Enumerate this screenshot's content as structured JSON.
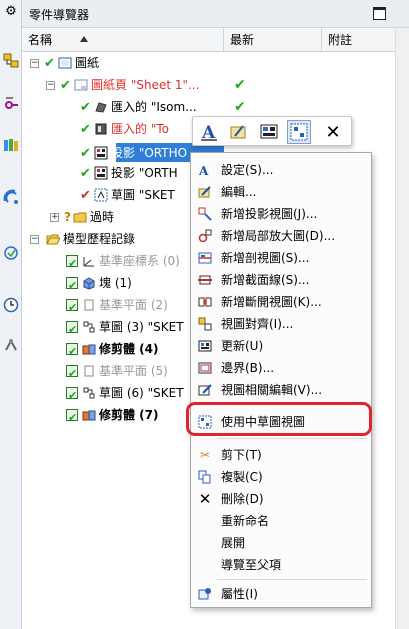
{
  "panel": {
    "title": "零件導覽器",
    "columns": {
      "name": "名稱",
      "latest": "最新",
      "note": "附註"
    }
  },
  "tree": {
    "drawing": "圖紙",
    "sheet": "圖紙頁 \"Sheet 1\"...",
    "import1": "匯入的 \"Isom...",
    "import2": "匯入的 \"To",
    "proj1": "投影 \"ORTHO",
    "proj2": "投影 \"ORTH",
    "sketch0": "草圖 \"SKET",
    "outdated": "過時",
    "history": "模型歷程記錄",
    "datum_csys": "基準座標系 (0)",
    "block": "塊 (1)",
    "datum_plane2": "基準平面 (2)",
    "sketch3": "草圖 (3) \"SKET",
    "trim4": "修剪體 (4)",
    "datum_plane5": "基準平面 (5)",
    "sketch6": "草圖 (6) \"SKET",
    "trim7": "修剪體 (7)"
  },
  "menu": {
    "settings": "設定(S)...",
    "edit": "編輯...",
    "add_projected_view": "新增投影視圖(J)...",
    "add_detail_view": "新增局部放大圖(D)...",
    "add_section_view": "新增剖視圖(S)...",
    "add_section_line": "新增截面線(S)...",
    "add_break_view": "新增斷開視圖(K)...",
    "view_align": "視圖對齊(I)...",
    "update": "更新(U)",
    "boundary": "邊界(B)...",
    "view_dependent_edit": "視圖相關編輯(V)...",
    "use_sketch_view": "使用中草圖視圖",
    "cut": "剪下(T)",
    "copy": "複製(C)",
    "delete": "刪除(D)",
    "rename": "重新命名",
    "expand": "展開",
    "navigate_parent": "導覽至父項",
    "properties": "屬性(I)"
  },
  "colors": {
    "accent": "#2f7fd8",
    "check": "#1ea81e",
    "highlight": "#e0262c",
    "warning_text": "#e03030"
  }
}
